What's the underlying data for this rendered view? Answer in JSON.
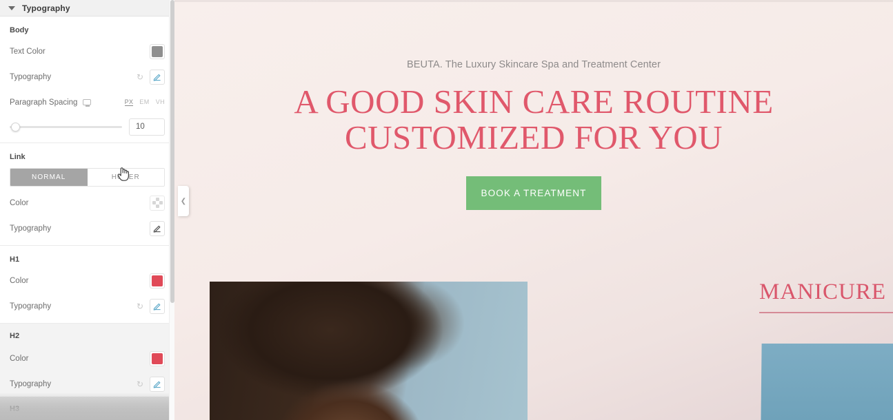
{
  "panel": {
    "title": "Typography",
    "caret_icon": "chevron-down-icon",
    "sections": {
      "body": {
        "label": "Body",
        "text_color": {
          "label": "Text Color",
          "value": "#8f8f8f"
        },
        "typography": {
          "label": "Typography",
          "reset_icon": "reset-icon",
          "edit_icon": "pencil-icon"
        },
        "paragraph_spacing": {
          "label": "Paragraph Spacing",
          "device_icon": "monitor-icon",
          "units": [
            "PX",
            "EM",
            "VH"
          ],
          "active_unit": "PX",
          "value": "10"
        }
      },
      "link": {
        "label": "Link",
        "tabs": [
          {
            "label": "NORMAL",
            "active": true
          },
          {
            "label": "HOVER",
            "active": false
          }
        ],
        "color": {
          "label": "Color",
          "swatch_icon": "transparent-swatch-icon"
        },
        "typography": {
          "label": "Typography",
          "edit_icon": "pencil-icon"
        }
      },
      "h1": {
        "label": "H1",
        "color": {
          "label": "Color",
          "value": "#e04a58"
        },
        "typography": {
          "label": "Typography",
          "reset_icon": "reset-icon",
          "edit_icon": "pencil-icon"
        }
      },
      "h2": {
        "label": "H2",
        "color": {
          "label": "Color",
          "value": "#e04a58"
        },
        "typography": {
          "label": "Typography",
          "reset_icon": "reset-icon",
          "edit_icon": "pencil-icon"
        }
      },
      "h3": {
        "label": "H3"
      }
    },
    "collapse_handle_icon": "chevron-left-icon"
  },
  "preview": {
    "eyebrow": "BEUTA. The Luxury Skincare Spa and Treatment Center",
    "headline_line1": "A GOOD SKIN CARE ROUTINE",
    "headline_line2": "CUSTOMIZED FOR YOU",
    "cta_label": "BOOK A TREATMENT",
    "service_label": "MANICURE",
    "service_arrow": "→",
    "colors": {
      "headline": "#e0586b",
      "cta_background": "#74bd78",
      "background": "#f6ebe8",
      "service_link": "#d9566b"
    }
  },
  "cursor": {
    "type": "pointer-hand-cursor"
  }
}
